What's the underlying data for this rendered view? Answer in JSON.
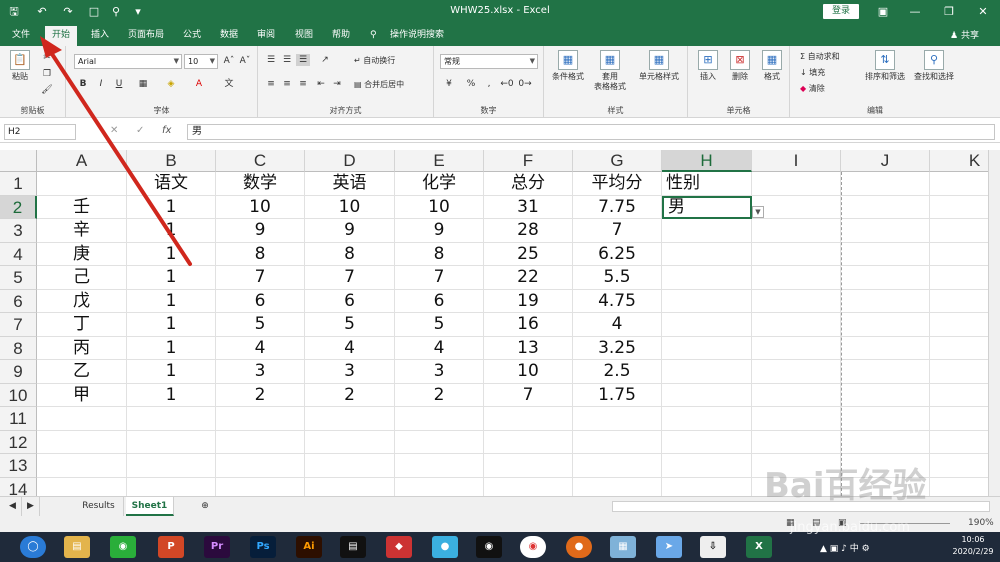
{
  "titlebar": {
    "title": "WHW25.xlsx  -  Excel",
    "login": "登录"
  },
  "tabs": [
    "文件",
    "开始",
    "插入",
    "页面布局",
    "公式",
    "数据",
    "审阅",
    "视图",
    "帮助",
    "操作说明搜索"
  ],
  "share": "共享",
  "ribbon": {
    "paste": "粘贴",
    "clipboard": "剪贴板",
    "font_name": "Arial",
    "font_size": "10",
    "font_group": "字体",
    "wrap": "自动换行",
    "merge": "合并后居中",
    "align_group": "对齐方式",
    "number_format": "常规",
    "number_group": "数字",
    "cond_format": "条件格式",
    "table_format_1": "套用",
    "table_format_2": "表格格式",
    "cell_style": "单元格样式",
    "style_group": "样式",
    "insert": "插入",
    "delete": "删除",
    "format": "格式",
    "cells_group": "单元格",
    "autosum": "自动求和",
    "fill": "填充",
    "clear": "清除",
    "sort_filter": "排序和筛选",
    "find_select": "查找和选择",
    "edit_group": "编辑"
  },
  "formula_bar": {
    "name_box": "H2",
    "fx": "fx",
    "content": "男"
  },
  "columns": [
    "A",
    "B",
    "C",
    "D",
    "E",
    "F",
    "G",
    "H",
    "I",
    "J",
    "K"
  ],
  "rows": [
    "1",
    "2",
    "3",
    "4",
    "5",
    "6",
    "7",
    "8",
    "9",
    "10",
    "11",
    "12",
    "13",
    "14"
  ],
  "table": {
    "header": [
      "",
      "语文",
      "数学",
      "英语",
      "化学",
      "总分",
      "平均分",
      "性别"
    ],
    "data": [
      [
        "壬",
        "1",
        "10",
        "10",
        "10",
        "31",
        "7.75",
        "男"
      ],
      [
        "辛",
        "1",
        "9",
        "9",
        "9",
        "28",
        "7",
        ""
      ],
      [
        "庚",
        "1",
        "8",
        "8",
        "8",
        "25",
        "6.25",
        ""
      ],
      [
        "己",
        "1",
        "7",
        "7",
        "7",
        "22",
        "5.5",
        ""
      ],
      [
        "戊",
        "1",
        "6",
        "6",
        "6",
        "19",
        "4.75",
        ""
      ],
      [
        "丁",
        "1",
        "5",
        "5",
        "5",
        "16",
        "4",
        ""
      ],
      [
        "丙",
        "1",
        "4",
        "4",
        "4",
        "13",
        "3.25",
        ""
      ],
      [
        "乙",
        "1",
        "3",
        "3",
        "3",
        "10",
        "2.5",
        ""
      ],
      [
        "甲",
        "1",
        "2",
        "2",
        "2",
        "7",
        "1.75",
        ""
      ]
    ]
  },
  "sheets": [
    "Results",
    "Sheet1"
  ],
  "active_sheet": "Sheet1",
  "zoom": "190%",
  "clock": {
    "time": "10:06",
    "date": "2020/2/29"
  },
  "watermark": "Bai百经验",
  "watermark_url": "jingyan.baidu.com",
  "colors": {
    "excel_green": "#217346",
    "arrow": "#d0271d"
  }
}
